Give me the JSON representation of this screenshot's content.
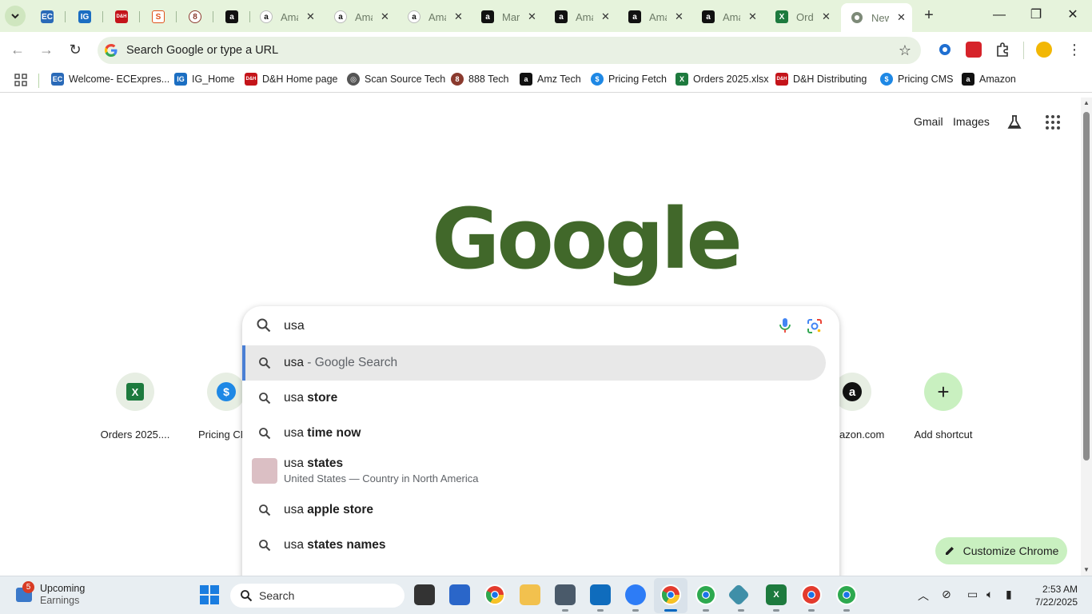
{
  "tabs": {
    "pinned": [
      {
        "name": "ec-express",
        "fav": "EC",
        "color": "#2a6ab8"
      },
      {
        "name": "ig-home",
        "fav": "IG",
        "color": "#1b6ec2"
      },
      {
        "name": "dh-home",
        "fav": "D&H",
        "color": "#c4141a"
      },
      {
        "name": "scan-source",
        "fav": "S",
        "color": "#e0521b"
      },
      {
        "name": "888-tech",
        "fav": "8",
        "color": "#8a3a2e"
      },
      {
        "name": "amazon",
        "fav": "a",
        "color": "#111111"
      }
    ],
    "items": [
      {
        "title": "Ama",
        "fav": "a"
      },
      {
        "title": "Ama",
        "fav": "a"
      },
      {
        "title": "Ama",
        "fav": "a"
      },
      {
        "title": "Mar",
        "fav": "a"
      },
      {
        "title": "Ama",
        "fav": "a"
      },
      {
        "title": "Ama",
        "fav": "a"
      },
      {
        "title": "Ama",
        "fav": "a"
      },
      {
        "title": "Ord",
        "fav": "X"
      }
    ],
    "active": {
      "title": "New"
    }
  },
  "omnibox": {
    "placeholder": "Search Google or type a URL"
  },
  "bookmarks": [
    {
      "label": "Welcome- ECExpres...",
      "fav": "EC",
      "color": "#2a6ab8"
    },
    {
      "label": "IG_Home",
      "fav": "IG",
      "color": "#1b6ec2"
    },
    {
      "label": "D&H Home page",
      "fav": "D&H",
      "color": "#c4141a"
    },
    {
      "label": "Scan Source Tech",
      "fav": "◎",
      "color": "#555555"
    },
    {
      "label": "888 Tech",
      "fav": "8",
      "color": "#8a3a2e"
    },
    {
      "label": "Amz Tech",
      "fav": "a",
      "color": "#111111"
    },
    {
      "label": "Pricing Fetch",
      "fav": "$",
      "color": "#1e88e5"
    },
    {
      "label": "Orders 2025.xlsx",
      "fav": "X",
      "color": "#1d7a3e"
    },
    {
      "label": "D&H Distributing",
      "fav": "D&H",
      "color": "#c4141a"
    },
    {
      "label": "Pricing CMS",
      "fav": "$",
      "color": "#1e88e5"
    },
    {
      "label": "Amazon",
      "fav": "a",
      "color": "#111111"
    }
  ],
  "ntp": {
    "gmail": "Gmail",
    "images": "Images",
    "logo": "Google",
    "shortcuts": [
      {
        "label": "Orders 2025....",
        "icon": "X",
        "color": "#1d7a3e"
      },
      {
        "label": "Pricing CM",
        "icon": "$",
        "color": "#1e88e5"
      },
      {
        "label": "azon.com",
        "icon": "a",
        "color": "#111111"
      },
      {
        "label": "Add shortcut",
        "icon": "+",
        "color": "#1f1f1f"
      }
    ],
    "customize": "Customize Chrome"
  },
  "search": {
    "query": "usa",
    "suggestions": [
      {
        "prefix": "usa",
        "bold": "",
        "suffix": " - Google Search"
      },
      {
        "prefix": "usa",
        "bold": " store",
        "suffix": ""
      },
      {
        "prefix": "usa",
        "bold": " time now",
        "suffix": ""
      },
      {
        "prefix": "usa",
        "bold": " states",
        "suffix": "",
        "subline": "United States — Country in North America"
      },
      {
        "prefix": "usa",
        "bold": " apple store",
        "suffix": ""
      },
      {
        "prefix": "usa",
        "bold": " states names",
        "suffix": ""
      }
    ]
  },
  "taskbar": {
    "widget_badge": "5",
    "widget_title": "Upcoming",
    "widget_subtitle": "Earnings",
    "search_label": "Search",
    "time": "2:53 AM",
    "date": "7/22/2025"
  }
}
